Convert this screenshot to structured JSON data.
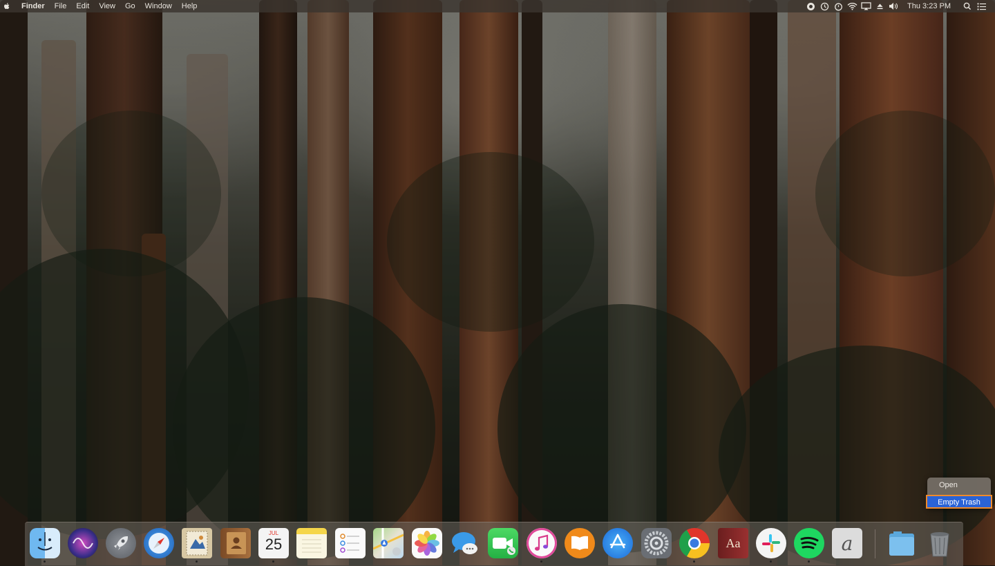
{
  "menubar": {
    "app_name": "Finder",
    "menus": [
      "File",
      "Edit",
      "View",
      "Go",
      "Window",
      "Help"
    ],
    "clock": "Thu 3:23 PM",
    "status_icons": [
      "creative-cloud-icon",
      "time-machine-icon",
      "timer-icon",
      "wifi-icon",
      "airplay-icon",
      "eject-icon",
      "volume-icon"
    ]
  },
  "dock": {
    "apps": [
      "Finder",
      "Siri",
      "Launchpad",
      "Safari",
      "Mail",
      "Contacts",
      "Calendar",
      "Notes",
      "Reminders",
      "Maps",
      "Photos",
      "Messages",
      "FaceTime",
      "iTunes",
      "iBooks",
      "App Store",
      "System Preferences",
      "Google Chrome",
      "Dictionary",
      "Slack",
      "Spotify",
      "Script Editor",
      "Downloads",
      "Trash"
    ],
    "calendar_month": "JUL",
    "calendar_day": "25",
    "dictionary_glyph": "Aa",
    "script_glyph": "a"
  },
  "context_menu": {
    "items": [
      "Open",
      "Empty Trash"
    ],
    "highlighted": "Empty Trash"
  },
  "colors": {
    "highlight": "#2a63d6",
    "annotation_outline": "#ef8b2b"
  }
}
